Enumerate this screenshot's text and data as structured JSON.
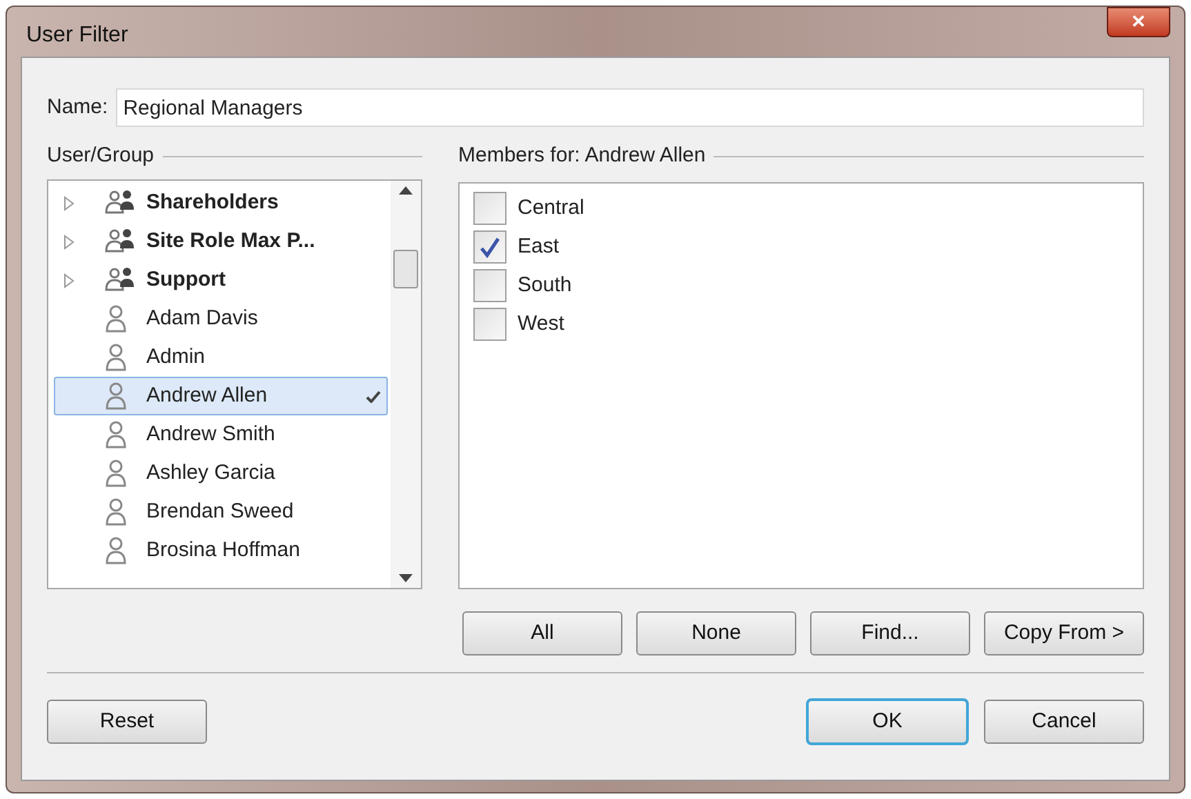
{
  "window": {
    "title": "User Filter",
    "close": "✕"
  },
  "name_field": {
    "label": "Name:",
    "value": "Regional Managers"
  },
  "user_group": {
    "label": "User/Group",
    "items": [
      {
        "kind": "group",
        "label": "Shareholders",
        "expanded": false,
        "selected": false
      },
      {
        "kind": "group",
        "label": "Site Role Max P...",
        "expanded": false,
        "selected": false
      },
      {
        "kind": "group",
        "label": "Support",
        "expanded": false,
        "selected": false
      },
      {
        "kind": "user",
        "label": "Adam Davis",
        "selected": false
      },
      {
        "kind": "user",
        "label": "Admin",
        "selected": false
      },
      {
        "kind": "user",
        "label": "Andrew Allen",
        "selected": true
      },
      {
        "kind": "user",
        "label": "Andrew Smith",
        "selected": false
      },
      {
        "kind": "user",
        "label": "Ashley Garcia",
        "selected": false
      },
      {
        "kind": "user",
        "label": "Brendan Sweed",
        "selected": false
      },
      {
        "kind": "user",
        "label": "Brosina Hoffman",
        "selected": false
      }
    ]
  },
  "members": {
    "label": "Members for: Andrew Allen",
    "items": [
      {
        "label": "Central",
        "checked": false
      },
      {
        "label": "East",
        "checked": true
      },
      {
        "label": "South",
        "checked": false
      },
      {
        "label": "West",
        "checked": false
      }
    ],
    "buttons": [
      "All",
      "None",
      "Find...",
      "Copy From >"
    ]
  },
  "footer": {
    "buttons": [
      {
        "label": "Reset",
        "default": false
      },
      {
        "label": "OK",
        "default": true
      },
      {
        "label": "Cancel",
        "default": false
      }
    ]
  }
}
